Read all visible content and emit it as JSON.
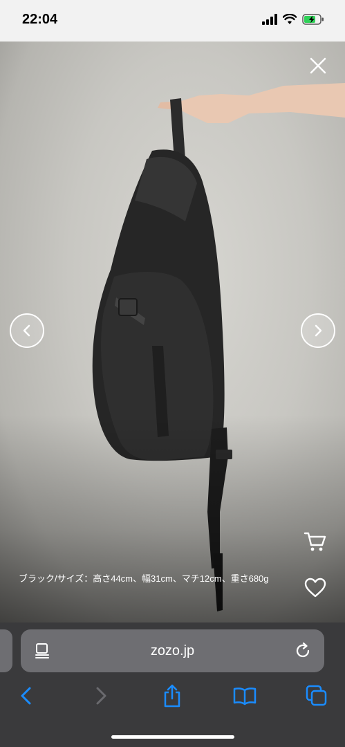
{
  "status_bar": {
    "time": "22:04"
  },
  "viewer": {
    "caption": "ブラック/サイズ：高さ44cm、幅31cm、マチ12cm、重さ680g"
  },
  "browser": {
    "url": "zozo.jp"
  },
  "colors": {
    "safari_blue": "#1a8cff",
    "battery_green": "#30d158",
    "chrome_bg": "#3a3a3c",
    "url_bar_bg": "#6e6e72"
  },
  "icons": {
    "close": "close-icon",
    "prev": "chevron-left-icon",
    "next": "chevron-right-icon",
    "cart": "cart-icon",
    "favorite": "heart-icon",
    "reader": "reader-icon",
    "reload": "reload-icon",
    "back": "back-icon",
    "forward": "forward-icon",
    "share": "share-icon",
    "bookmarks": "book-icon",
    "tabs": "tabs-icon"
  }
}
